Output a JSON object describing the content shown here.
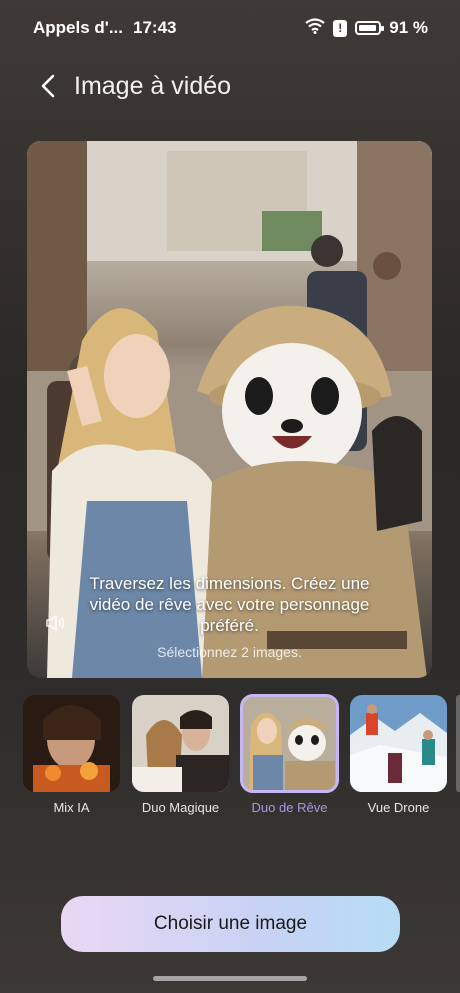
{
  "status": {
    "carrier": "Appels d'...",
    "time": "17:43",
    "battery": "91 %",
    "battery_level": 0.91
  },
  "header": {
    "title": "Image à vidéo"
  },
  "preview": {
    "caption": "Traversez les dimensions. Créez une vidéo de rêve avec votre personnage préféré.",
    "hint": "Sélectionnez 2 images."
  },
  "templates": [
    {
      "label": "Mix IA",
      "selected": false
    },
    {
      "label": "Duo Magique",
      "selected": false
    },
    {
      "label": "Duo de Rêve",
      "selected": true
    },
    {
      "label": "Vue Drone",
      "selected": false
    }
  ],
  "actions": {
    "choose_label": "Choisir une image"
  },
  "colors": {
    "accent": "#a996e8",
    "button_start": "#ead7f4",
    "button_end": "#b6dcf5"
  }
}
